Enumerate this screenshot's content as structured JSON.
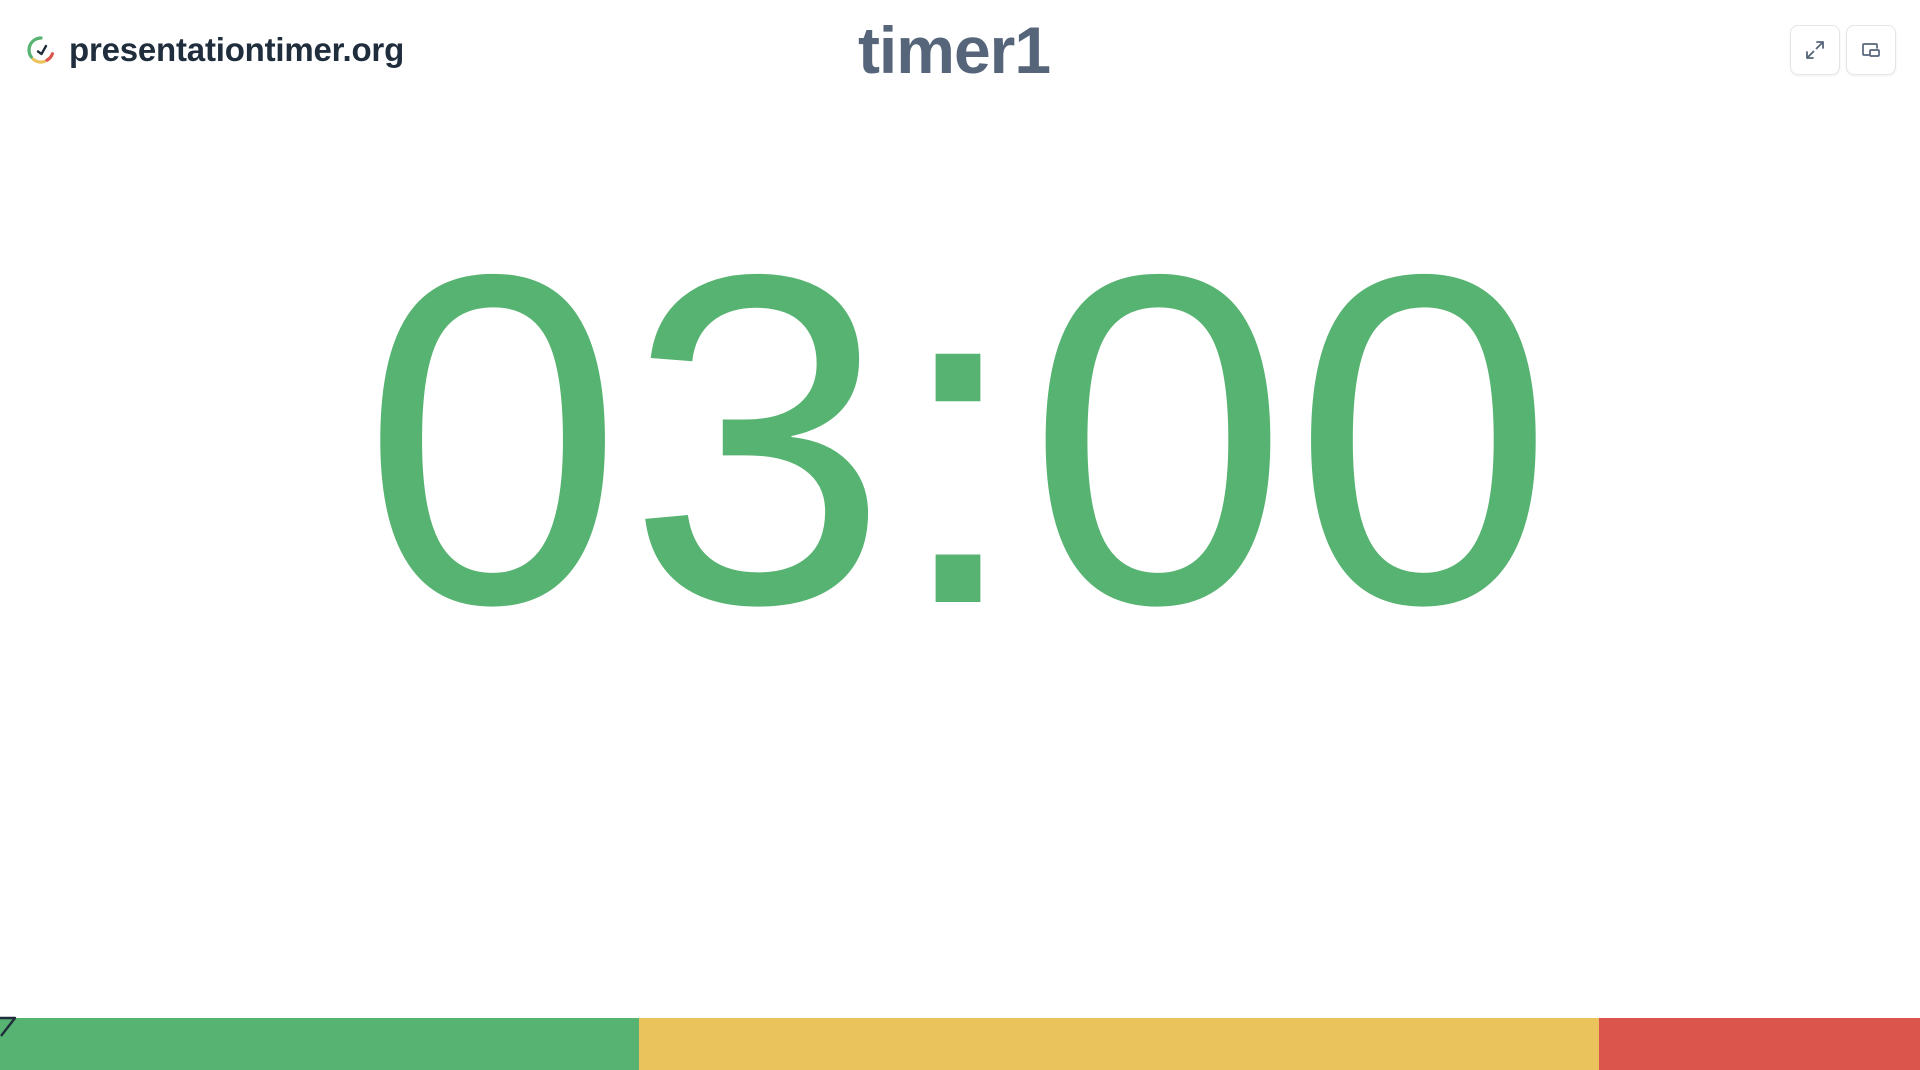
{
  "brand": {
    "name": "presentationtimer.org",
    "logo_icon": "timer-logo-icon"
  },
  "timer": {
    "title": "timer1",
    "display": "03:00",
    "color": "#57b371"
  },
  "controls": {
    "fullscreen_icon": "expand-icon",
    "pip_icon": "picture-in-picture-icon"
  },
  "progress": {
    "segments": [
      {
        "name": "green",
        "color": "#57b371",
        "share": 0.333
      },
      {
        "name": "yellow",
        "color": "#ebc35c",
        "share": 0.5
      },
      {
        "name": "red",
        "color": "#db554c",
        "share": 0.167
      }
    ],
    "elapsed_fraction": 0
  }
}
